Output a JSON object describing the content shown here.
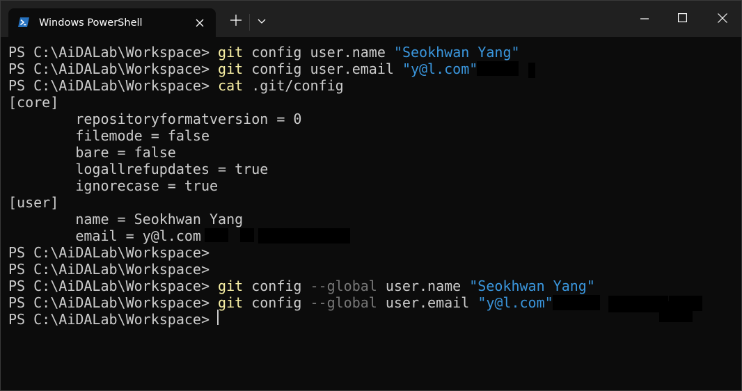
{
  "window": {
    "tab_title": "Windows PowerShell",
    "icons": {
      "tab_icon": "powershell-icon",
      "tab_close": "close-icon",
      "new_tab": "plus-icon",
      "dropdown": "chevron-down-icon",
      "minimize": "minimize-icon",
      "maximize": "maximize-icon",
      "close": "close-icon"
    }
  },
  "colors": {
    "background": "#0c0c0c",
    "titlebar": "#202020",
    "text": "#cccccc",
    "command": "#f9f1a5",
    "string": "#3a96dd",
    "parameter": "#767676"
  },
  "terminal": {
    "lines": [
      [
        {
          "t": "PS C:\\AiDALab\\Workspace> ",
          "c": "prompt"
        },
        {
          "t": "git",
          "c": "cmd"
        },
        {
          "t": " config user.name ",
          "c": "text"
        },
        {
          "t": "\"Seokhwan Yang\"",
          "c": "str"
        }
      ],
      [
        {
          "t": "PS C:\\AiDALab\\Workspace> ",
          "c": "prompt"
        },
        {
          "t": "git",
          "c": "cmd"
        },
        {
          "t": " config user.email ",
          "c": "text"
        },
        {
          "t": "\"y@l.com\"",
          "c": "str"
        }
      ],
      [
        {
          "t": "PS C:\\AiDALab\\Workspace> ",
          "c": "prompt"
        },
        {
          "t": "cat",
          "c": "cmd"
        },
        {
          "t": " .git/config",
          "c": "text"
        }
      ],
      [
        {
          "t": "[core]",
          "c": "text"
        }
      ],
      [
        {
          "t": "        repositoryformatversion = 0",
          "c": "text"
        }
      ],
      [
        {
          "t": "        filemode = false",
          "c": "text"
        }
      ],
      [
        {
          "t": "        bare = false",
          "c": "text"
        }
      ],
      [
        {
          "t": "        logallrefupdates = true",
          "c": "text"
        }
      ],
      [
        {
          "t": "        ignorecase = true",
          "c": "text"
        }
      ],
      [
        {
          "t": "[user]",
          "c": "text"
        }
      ],
      [
        {
          "t": "        name = Seokhwan Yang",
          "c": "text"
        }
      ],
      [
        {
          "t": "        email = y@l.com",
          "c": "text"
        }
      ],
      [
        {
          "t": "PS C:\\AiDALab\\Workspace>",
          "c": "prompt"
        }
      ],
      [
        {
          "t": "PS C:\\AiDALab\\Workspace>",
          "c": "prompt"
        }
      ],
      [
        {
          "t": "PS C:\\AiDALab\\Workspace> ",
          "c": "prompt"
        },
        {
          "t": "git",
          "c": "cmd"
        },
        {
          "t": " config ",
          "c": "text"
        },
        {
          "t": "--global",
          "c": "param"
        },
        {
          "t": " user.name ",
          "c": "text"
        },
        {
          "t": "\"Seokhwan Yang\"",
          "c": "str"
        }
      ],
      [
        {
          "t": "PS C:\\AiDALab\\Workspace> ",
          "c": "prompt"
        },
        {
          "t": "git",
          "c": "cmd"
        },
        {
          "t": " config ",
          "c": "text"
        },
        {
          "t": "--global",
          "c": "param"
        },
        {
          "t": " user.email ",
          "c": "text"
        },
        {
          "t": "\"y@l.com\"",
          "c": "str"
        }
      ],
      [
        {
          "t": "PS C:\\AiDALab\\Workspace> ",
          "c": "prompt"
        }
      ]
    ]
  }
}
